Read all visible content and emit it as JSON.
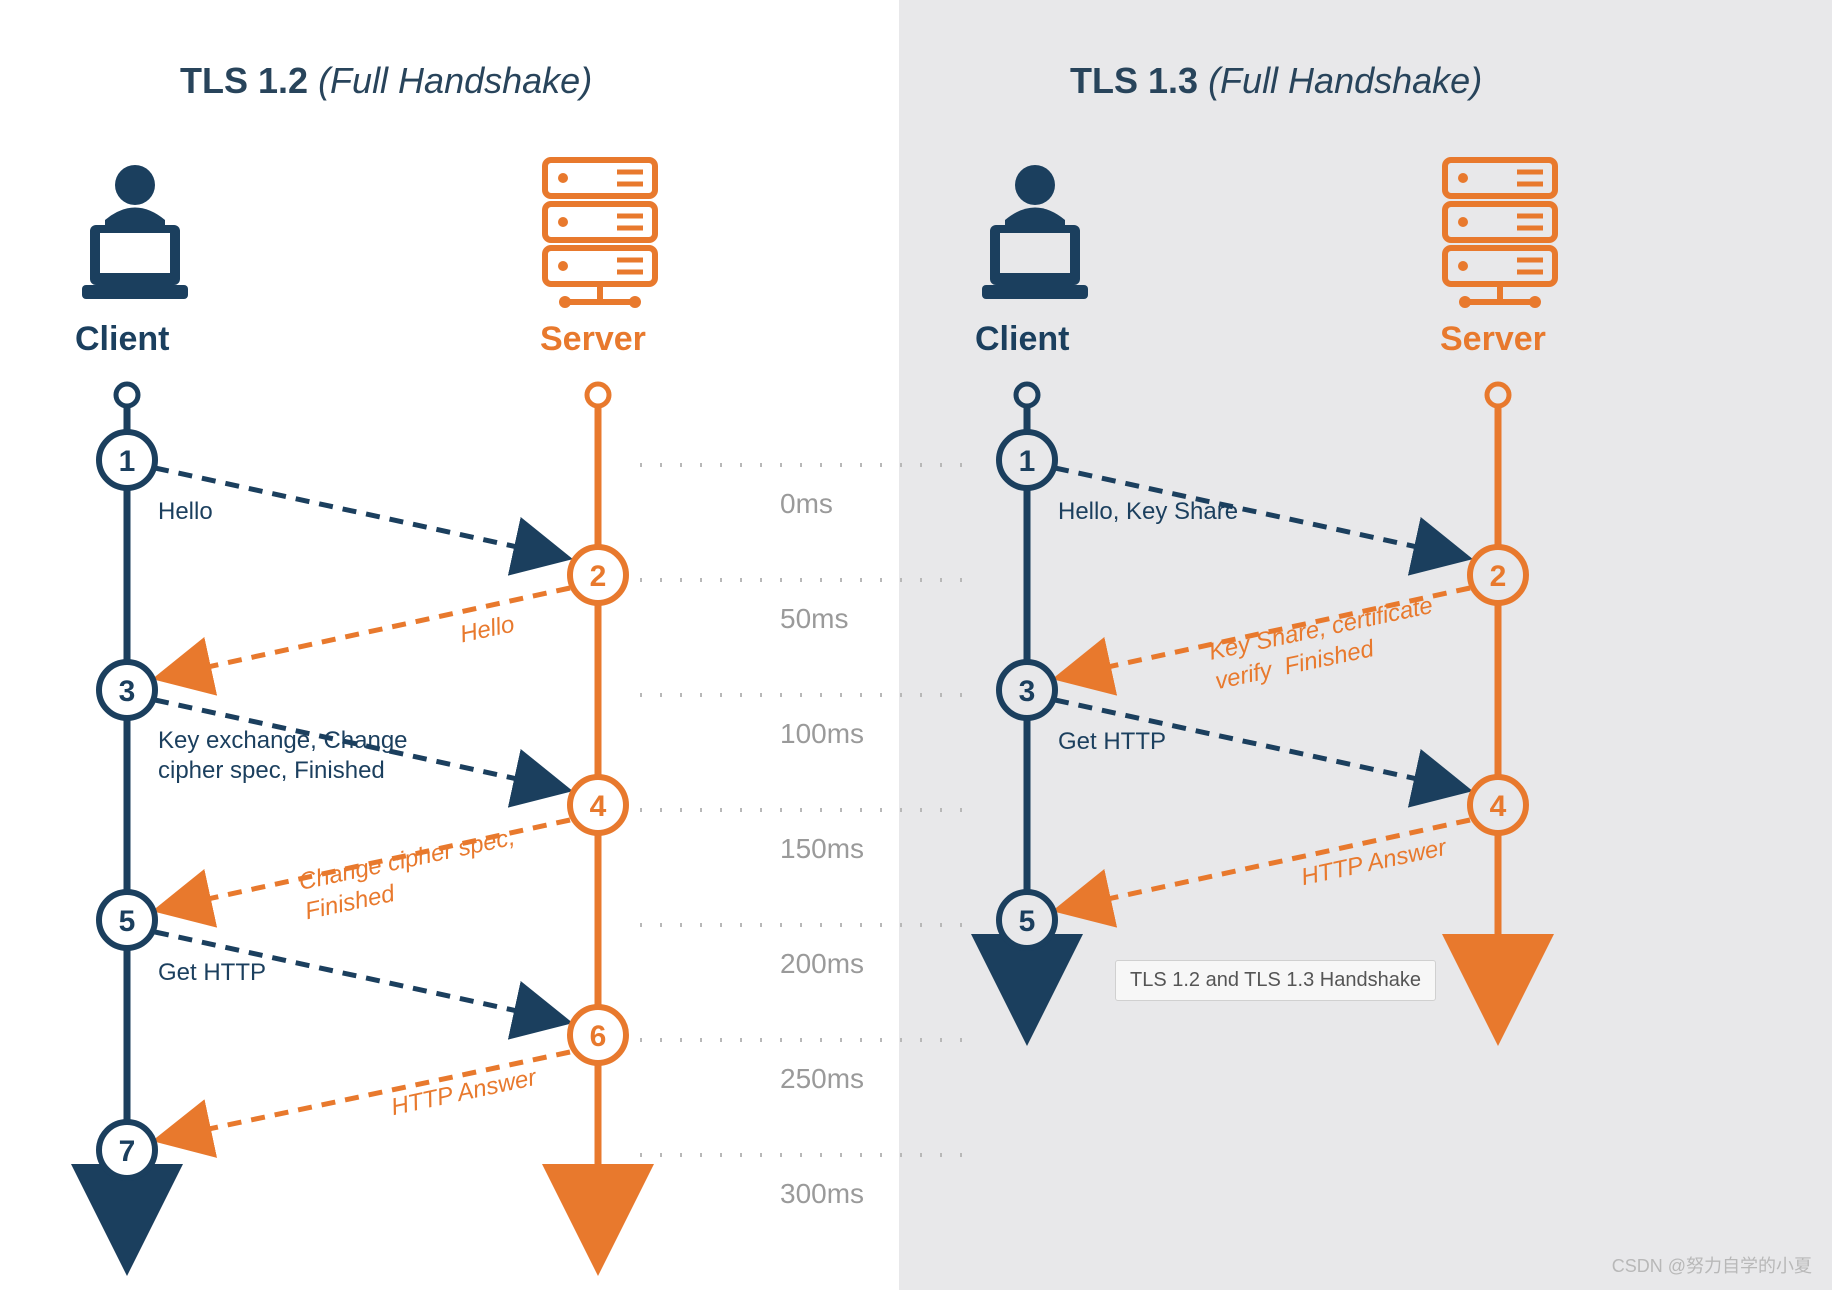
{
  "left": {
    "title_strong": "TLS 1.2",
    "title_em": "(Full Handshake)",
    "client_label": "Client",
    "server_label": "Server",
    "messages": {
      "m1": "Hello",
      "m2": "Hello",
      "m3": "Key exchange, Change\ncipher spec, Finished",
      "m4": "Change cipher spec,\nFinished",
      "m5": "Get HTTP",
      "m6": "HTTP Answer"
    },
    "steps": [
      "1",
      "2",
      "3",
      "4",
      "5",
      "6",
      "7"
    ]
  },
  "right": {
    "title_strong": "TLS 1.3",
    "title_em": "(Full Handshake)",
    "client_label": "Client",
    "server_label": "Server",
    "messages": {
      "m1": "Hello, Key Share",
      "m2": "Key Share, certificate\nverify  Finished",
      "m3": "Get HTTP",
      "m4": "HTTP Answer"
    },
    "steps": [
      "1",
      "2",
      "3",
      "4",
      "5"
    ]
  },
  "timeline": {
    "t0": "0ms",
    "t1": "50ms",
    "t2": "100ms",
    "t3": "150ms",
    "t4": "200ms",
    "t5": "250ms",
    "t6": "300ms"
  },
  "tooltip": "TLS 1.2 and TLS 1.3 Handshake",
  "colors": {
    "blue": "#1b3f5e",
    "orange": "#e8792d",
    "grey": "#b8b8b8"
  },
  "watermark": "CSDN @努力自学的小夏"
}
